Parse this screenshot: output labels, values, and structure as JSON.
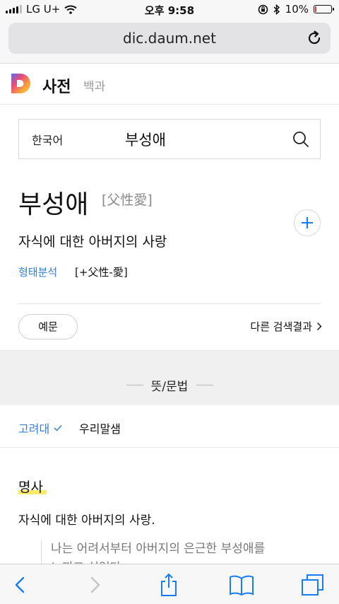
{
  "status_bar": {
    "carrier": "LG U+",
    "time": "오후 9:58",
    "battery_percent": 10,
    "battery_text": "10%"
  },
  "browser": {
    "url": "dic.daum.net",
    "reload_icon": "reload-icon"
  },
  "header": {
    "logo_icon": "daum-logo-icon",
    "title": "사전",
    "encyclopedia_link": "백과"
  },
  "search": {
    "language": "한국어",
    "query": "부성애",
    "search_icon": "search-icon"
  },
  "entry": {
    "headword": "부성애",
    "hanja": "[父性愛]",
    "summary": "자식에 대한 아버지의 사랑",
    "morphology_label": "형태분석",
    "morphology_value": "[+父性-愛]",
    "example_button": "예문",
    "other_results": "다른 검색결과"
  },
  "section": {
    "title": "뜻/문법"
  },
  "sources": {
    "active": "고려대",
    "other": "우리말샘"
  },
  "meaning": {
    "part_of_speech": "명사",
    "sense": "자식에 대한 아버지의 사랑.",
    "example_line1": "나는 어려서부터 아버지의 은근한 부성애를",
    "example_line2": "느끼고 싶었다"
  },
  "colors": {
    "link_blue": "#3a7fd0",
    "battery_red": "#e0312a",
    "ios_blue": "#1a7cf5",
    "highlight_yellow": "#f7e84f"
  },
  "toolbar": {
    "items": [
      "back-icon",
      "forward-icon",
      "share-icon",
      "bookmarks-icon",
      "tabs-icon"
    ]
  }
}
